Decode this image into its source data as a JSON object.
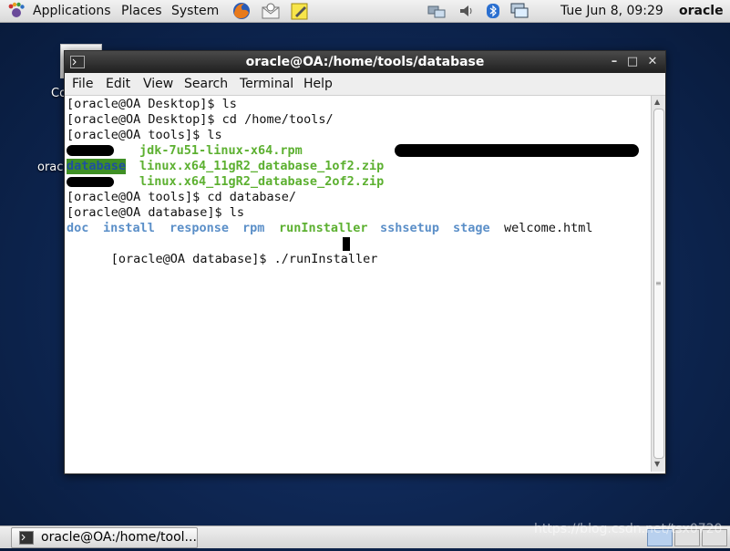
{
  "top_panel": {
    "menus": [
      "Applications",
      "Places",
      "System"
    ],
    "clock": "Tue Jun  8, 09:29",
    "user": "oracle"
  },
  "desktop": {
    "icons": [
      {
        "label": "Co"
      },
      {
        "label": "oracl"
      }
    ]
  },
  "window": {
    "title": "oracle@OA:/home/tools/database",
    "menu": [
      "File",
      "Edit",
      "View",
      "Search",
      "Terminal",
      "Help"
    ]
  },
  "terminal": {
    "lines": [
      "[oracle@OA Desktop]$ ls",
      "[oracle@OA Desktop]$ cd /home/tools/",
      "[oracle@OA tools]$ ls",
      "[oracle@OA tools]$ cd database/",
      "[oracle@OA database]$ ls",
      "[oracle@OA database]$ ./runInstaller "
    ],
    "ls_tools": [
      "jdk-7u51-linux-x64.rpm",
      "database",
      "linux.x64_11gR2_database_1of2.zip",
      "linux.x64_11gR2_database_2of2.zip"
    ],
    "ls_database": {
      "dirs": [
        "doc",
        "install",
        "response",
        "rpm"
      ],
      "exec": [
        "runInstaller"
      ],
      "dirs2": [
        "sshsetup",
        "stage"
      ],
      "files": [
        "welcome.html"
      ]
    }
  },
  "taskbar": {
    "task_label": "oracle@OA:/home/tool..."
  },
  "watermark": "https://blog.csdn.net/tsx0720",
  "colors": {
    "dir": "#5b8fc8",
    "exec": "#5cb030",
    "titlebar": "#2b2b2b"
  }
}
